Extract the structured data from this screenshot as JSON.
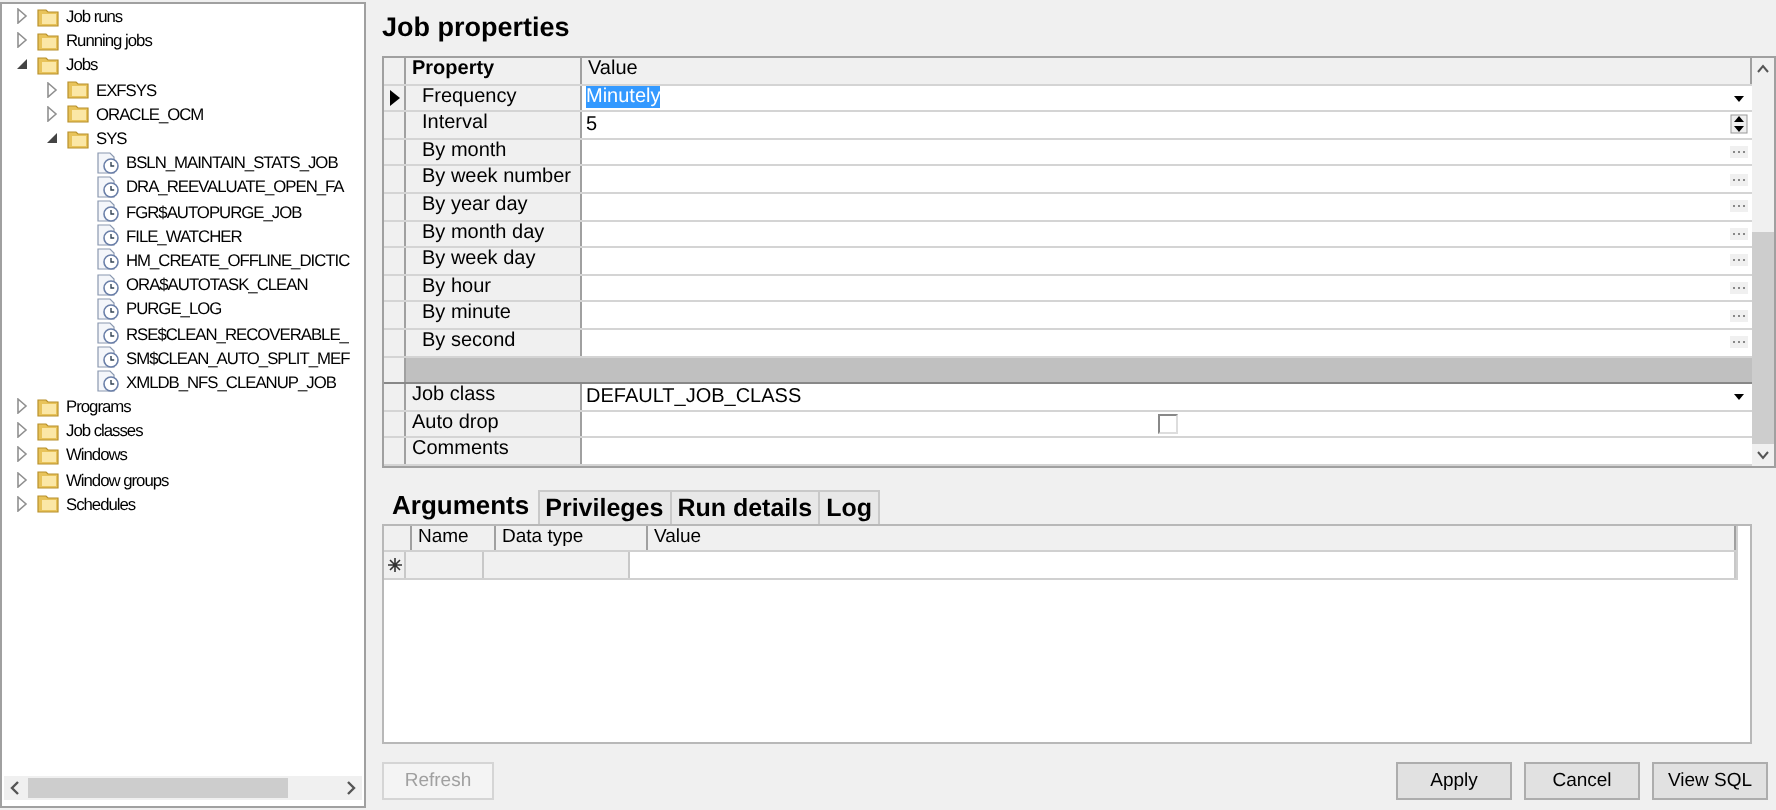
{
  "tree": [
    {
      "label": "Job runs",
      "kind": "folder",
      "expanded": false
    },
    {
      "label": "Running jobs",
      "kind": "folder",
      "expanded": false
    },
    {
      "label": "Jobs",
      "kind": "folder",
      "expanded": true,
      "children": [
        {
          "label": "EXFSYS",
          "kind": "folder",
          "expanded": false
        },
        {
          "label": "ORACLE_OCM",
          "kind": "folder",
          "expanded": false
        },
        {
          "label": "SYS",
          "kind": "folder",
          "expanded": true,
          "children": [
            {
              "label": "BSLN_MAINTAIN_STATS_JOB",
              "kind": "job"
            },
            {
              "label": "DRA_REEVALUATE_OPEN_FA",
              "kind": "job"
            },
            {
              "label": "FGR$AUTOPURGE_JOB",
              "kind": "job"
            },
            {
              "label": "FILE_WATCHER",
              "kind": "job"
            },
            {
              "label": "HM_CREATE_OFFLINE_DICTIC",
              "kind": "job"
            },
            {
              "label": "ORA$AUTOTASK_CLEAN",
              "kind": "job"
            },
            {
              "label": "PURGE_LOG",
              "kind": "job"
            },
            {
              "label": "RSE$CLEAN_RECOVERABLE_",
              "kind": "job"
            },
            {
              "label": "SM$CLEAN_AUTO_SPLIT_MEF",
              "kind": "job"
            },
            {
              "label": "XMLDB_NFS_CLEANUP_JOB",
              "kind": "job"
            }
          ]
        }
      ]
    },
    {
      "label": "Programs",
      "kind": "folder",
      "expanded": false
    },
    {
      "label": "Job classes",
      "kind": "folder",
      "expanded": false
    },
    {
      "label": "Windows",
      "kind": "folder",
      "expanded": false
    },
    {
      "label": "Window groups",
      "kind": "folder",
      "expanded": false
    },
    {
      "label": "Schedules",
      "kind": "folder",
      "expanded": false
    }
  ],
  "title": "Job properties",
  "property_grid": {
    "columns": [
      "Property",
      "Value"
    ],
    "sections": [
      {
        "rows": [
          {
            "name": "Frequency",
            "kind": "dropdown",
            "value": "Minutely",
            "current": true
          },
          {
            "name": "Interval",
            "kind": "spin",
            "value": "5",
            "current": false
          },
          {
            "name": "By month",
            "kind": "ellipsis",
            "current": false
          },
          {
            "name": "By week number",
            "kind": "ellipsis",
            "current": false
          },
          {
            "name": "By year day",
            "kind": "ellipsis",
            "current": false
          },
          {
            "name": "By month day",
            "kind": "ellipsis",
            "current": false
          },
          {
            "name": "By week day",
            "kind": "ellipsis",
            "current": false
          },
          {
            "name": "By hour",
            "kind": "ellipsis",
            "current": false
          },
          {
            "name": "By minute",
            "kind": "ellipsis",
            "current": false
          },
          {
            "name": "By second",
            "kind": "ellipsis",
            "current": false
          }
        ]
      },
      {
        "rows": [
          {
            "name": "Job class",
            "kind": "dropdown",
            "value": "DEFAULT_JOB_CLASS",
            "current": false
          },
          {
            "name": "Auto drop",
            "kind": "checkbox",
            "checked": false,
            "current": false
          },
          {
            "name": "Comments",
            "kind": "text",
            "current": false
          }
        ]
      }
    ]
  },
  "tabs": [
    {
      "label": "Arguments",
      "selected": true
    },
    {
      "label": "Privileges",
      "selected": false
    },
    {
      "label": "Run details",
      "selected": false
    },
    {
      "label": "Log",
      "selected": false
    }
  ],
  "arguments_table": {
    "columns": [
      "Name",
      "Data type",
      "Value"
    ]
  },
  "footer": {
    "left_buttons": [
      {
        "label": "Refresh",
        "disabled": true
      }
    ],
    "right_buttons": [
      {
        "label": "Apply",
        "disabled": false
      },
      {
        "label": "Cancel",
        "disabled": false
      },
      {
        "label": "View SQL",
        "disabled": false
      }
    ]
  }
}
